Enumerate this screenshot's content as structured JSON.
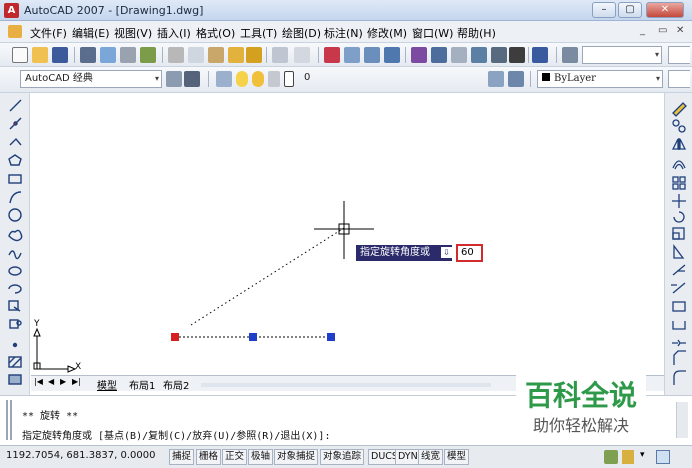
{
  "window": {
    "title": "AutoCAD 2007 - [Drawing1.dwg]",
    "app_icon": "A",
    "minimize": "–",
    "restore": "▢",
    "close": "✕"
  },
  "menu": {
    "items": [
      "文件(F)",
      "编辑(E)",
      "视图(V)",
      "插入(I)",
      "格式(O)",
      "工具(T)",
      "绘图(D)",
      "标注(N)",
      "修改(M)",
      "窗口(W)",
      "帮助(H)"
    ],
    "doc_controls": [
      "_",
      "▭",
      "✕"
    ]
  },
  "toolbar2": {
    "workspace": "AutoCAD 经典",
    "layer": "0",
    "color": "ByLayer"
  },
  "canvas": {
    "axis_y": "Y",
    "axis_x": "X"
  },
  "tooltip": {
    "prompt": "指定旋转角度或",
    "icon": "⇩",
    "value": "60"
  },
  "tabs": {
    "items": [
      "模型",
      "布局1",
      "布局2"
    ]
  },
  "command": {
    "line1": "** 旋转 **",
    "line2": "指定旋转角度或 [基点(B)/复制(C)/放弃(U)/参照(R)/退出(X)]:"
  },
  "status": {
    "coords": "1192.7054, 681.3837, 0.0000",
    "buttons": [
      "捕捉",
      "栅格",
      "正交",
      "极轴",
      "对象捕捉",
      "对象追踪",
      "DUCS",
      "DYN",
      "线宽",
      "模型"
    ]
  },
  "watermark": {
    "main": "百科全说",
    "sub": "助你轻松解决"
  },
  "colors": {
    "grip_red": "#d42020",
    "grip_blue": "#1f3fc8",
    "tooltip_bg": "#2b2b6b"
  }
}
